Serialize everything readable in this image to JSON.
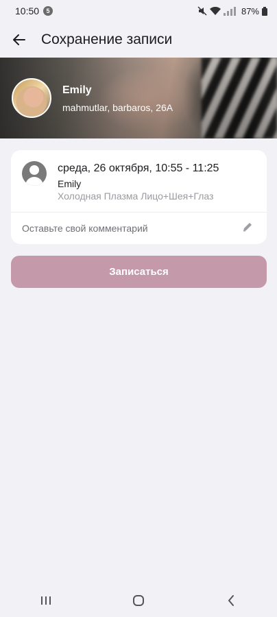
{
  "status_bar": {
    "time": "10:50",
    "notification_badge": "5",
    "battery": "87%",
    "icons": [
      "mute-icon",
      "wifi-icon",
      "signal-icon",
      "battery-icon"
    ]
  },
  "app_bar": {
    "title": "Сохранение записи",
    "back_icon": "arrow-left-icon"
  },
  "salon": {
    "name": "Emily",
    "address": "mahmutlar, barbaros, 26A"
  },
  "appointment": {
    "datetime": "среда, 26 октября, 10:55 - 11:25",
    "master": "Emily",
    "service": "Холодная Плазма Лицо+Шея+Глаз",
    "comment_placeholder": "Оставьте свой комментарий",
    "comment_value": ""
  },
  "submit": {
    "label": "Записаться",
    "color": "#c49aaa"
  },
  "nav": {
    "buttons": [
      "recents-icon",
      "home-icon",
      "back-icon"
    ]
  },
  "colors": {
    "background": "#f2f1f6",
    "card": "#ffffff"
  }
}
